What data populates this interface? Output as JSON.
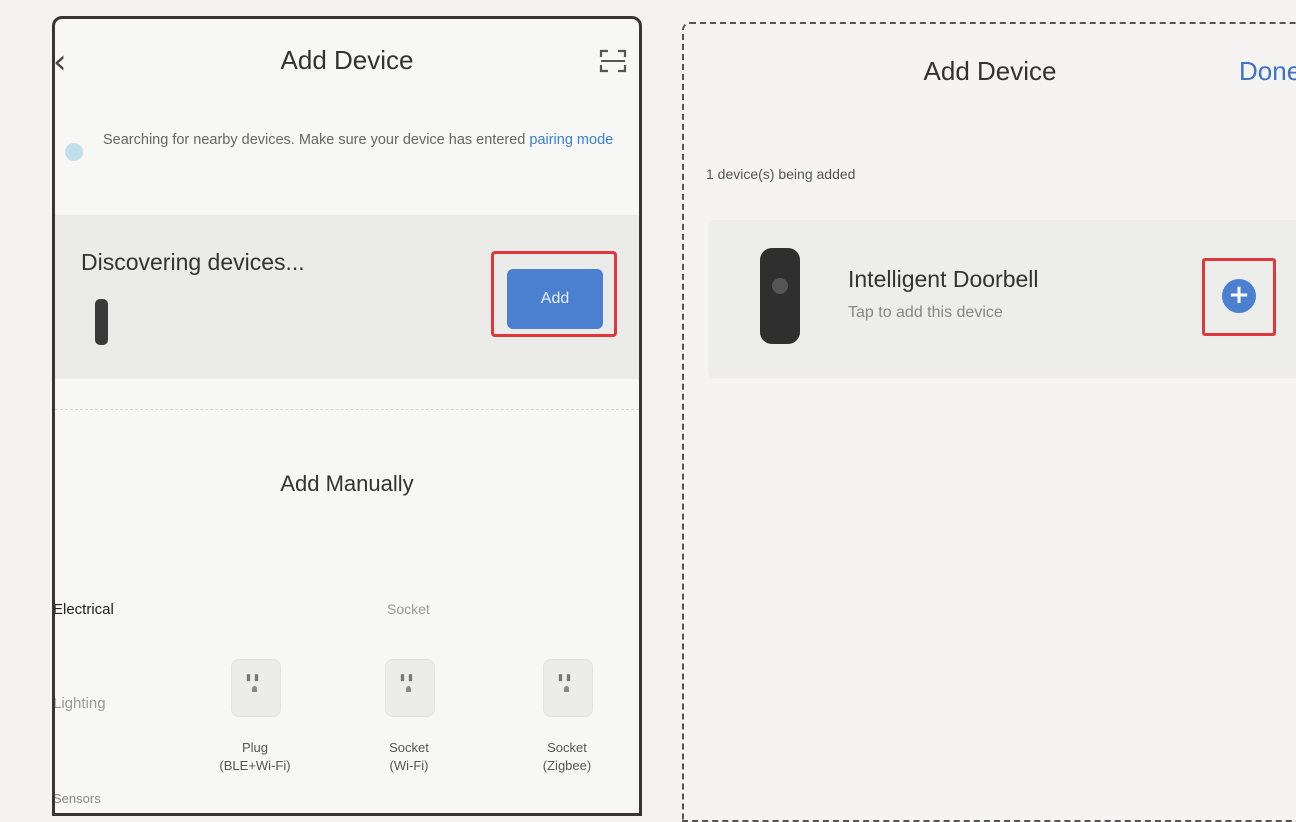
{
  "left_screen": {
    "header": {
      "back_icon": "chevron-left-icon",
      "title": "Add Device",
      "scan_icon": "scan-icon"
    },
    "search_tip": {
      "icon": "searching-icon",
      "text": "Searching for nearby devices. Make sure your device has entered ",
      "link": "pairing mode"
    },
    "discover": {
      "title": "Discovering devices...",
      "device_icon": "doorbell-device-icon",
      "add_label": "Add",
      "add_color": "#4b7fcf"
    },
    "manual": {
      "title": "Add Manually"
    },
    "categories": [
      {
        "label": "Electrical"
      },
      {
        "label": "Lighting"
      },
      {
        "label": "Sensors"
      }
    ],
    "section_heading": "Socket",
    "products": [
      {
        "name": "Plug",
        "variant": "(BLE+Wi-Fi)",
        "icon": "socket-icon"
      },
      {
        "name": "Socket",
        "variant": "(Wi-Fi)",
        "icon": "socket-icon"
      },
      {
        "name": "Socket",
        "variant": "(Zigbee)",
        "icon": "socket-icon"
      }
    ],
    "highlight_color": "#e0363c"
  },
  "right_screen": {
    "header": {
      "title": "Add Device",
      "done_label": "Done",
      "done_color": "#3b73c7"
    },
    "status": "1 device(s) being added",
    "device": {
      "icon": "doorbell-icon",
      "name": "Intelligent Doorbell",
      "hint": "Tap to add this device",
      "add_icon": "plus-icon",
      "add_symbol": "+"
    }
  }
}
